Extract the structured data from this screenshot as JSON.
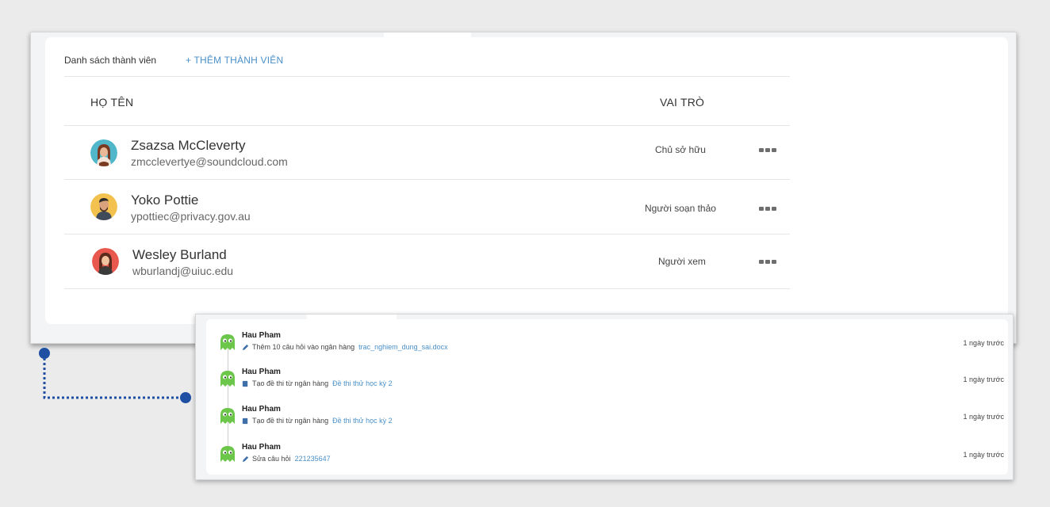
{
  "members": {
    "title": "Danh sách thành viên",
    "add_label": "+ THÊM THÀNH VIÊN",
    "col_name": "HỌ TÊN",
    "col_role": "VAI TRÒ",
    "rows": [
      {
        "name": "Zsazsa McCleverty",
        "email": "zmcclevertye@soundcloud.com",
        "role": "Chủ sở hữu",
        "avatar": "woman-avatar-teal"
      },
      {
        "name": "Yoko Pottie",
        "email": "ypottiec@privacy.gov.au",
        "role": "Người soạn thảo",
        "avatar": "man-avatar-yellow"
      },
      {
        "name": "Wesley Burland",
        "email": "wburlandj@uiuc.edu",
        "role": "Người xem",
        "avatar": "woman-avatar-red"
      }
    ]
  },
  "activity": {
    "items": [
      {
        "user": "Hau Pham",
        "icon": "pencil-icon",
        "action": "Thêm 10 câu hỏi vào ngân hàng",
        "link": "trac_nghiem_dung_sai.docx",
        "time": "1 ngày trước"
      },
      {
        "user": "Hau Pham",
        "icon": "book-icon",
        "action": "Tạo đề thi từ ngân hàng",
        "link": "Đề thi thử học kỳ 2",
        "time": "1 ngày trước"
      },
      {
        "user": "Hau Pham",
        "icon": "book-icon",
        "action": "Tạo đề thi từ ngân hàng",
        "link": "Đề thi thử học kỳ 2",
        "time": "1 ngày trước"
      },
      {
        "user": "Hau Pham",
        "icon": "pencil-icon",
        "action": "Sửa câu hỏi",
        "link": "221235647",
        "time": "1 ngày trước"
      }
    ]
  },
  "colors": {
    "accent": "#4a90c8",
    "connector": "#1f4fa3",
    "ghost": "#6cc64a"
  }
}
